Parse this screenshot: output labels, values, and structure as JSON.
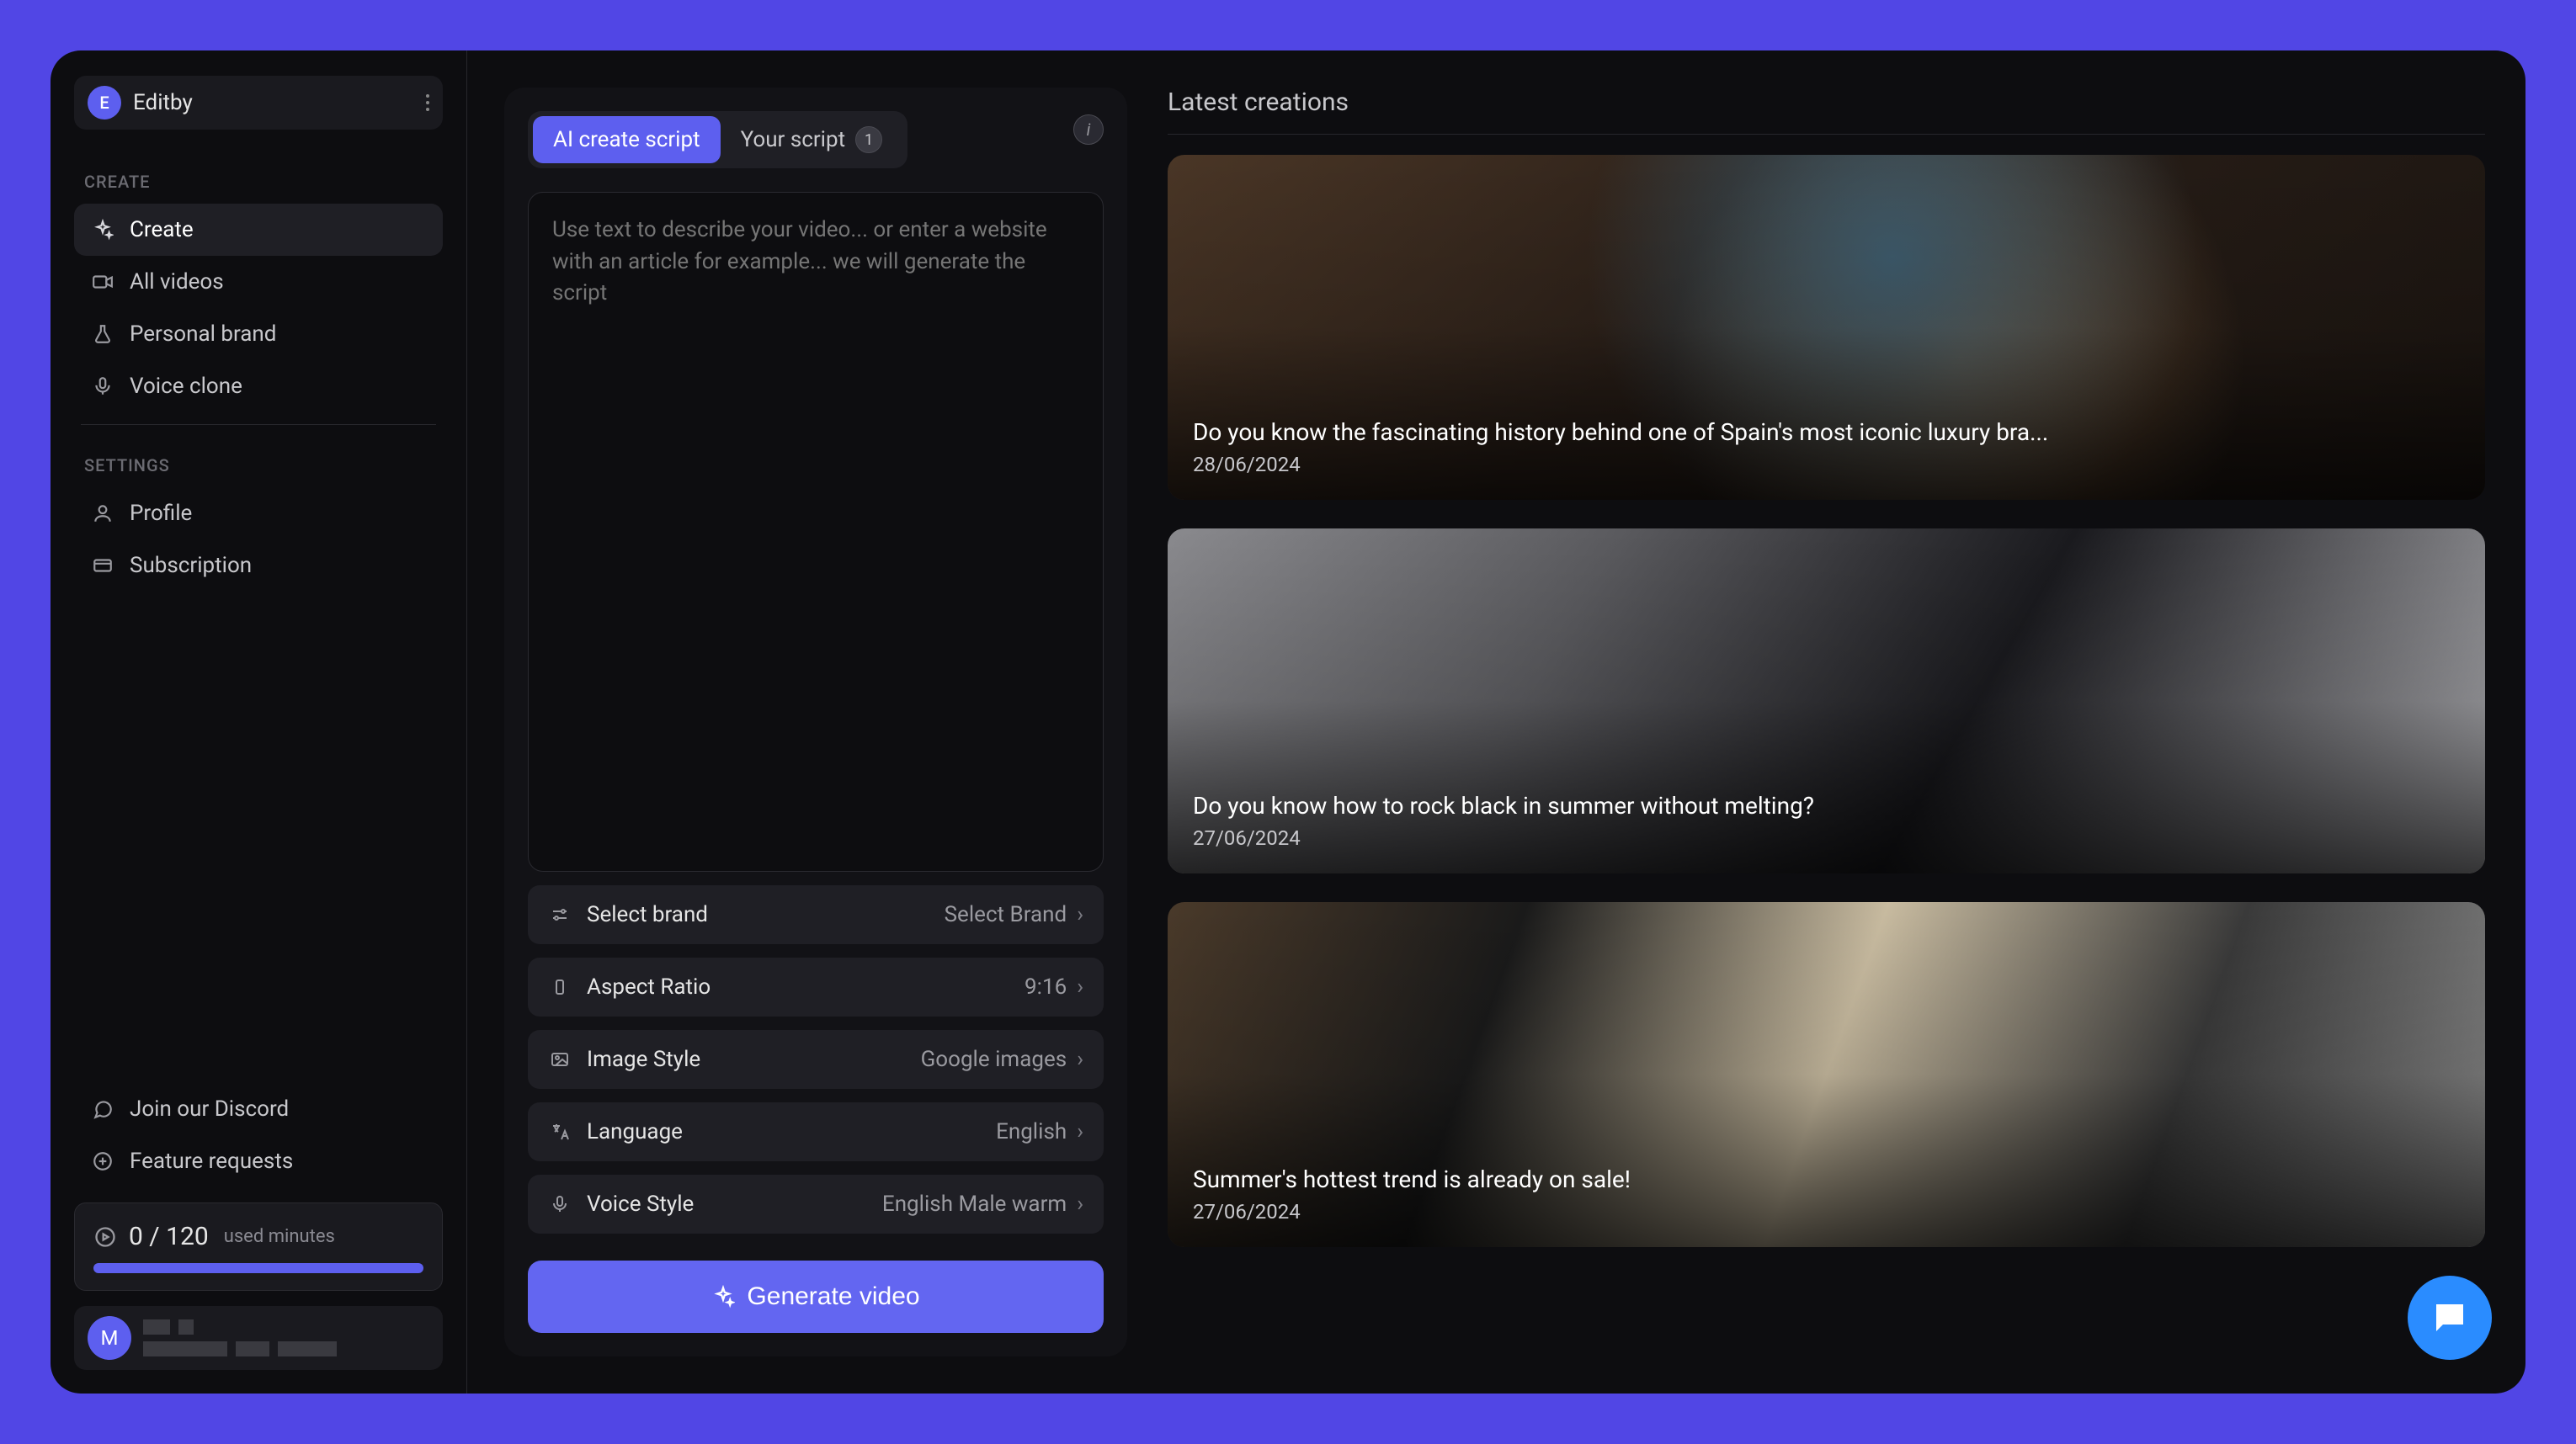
{
  "brand": {
    "avatar_letter": "E",
    "name": "Editby"
  },
  "sidebar": {
    "sections": {
      "create_label": "CREATE",
      "settings_label": "SETTINGS"
    },
    "items": {
      "create": "Create",
      "all_videos": "All videos",
      "personal_brand": "Personal brand",
      "voice_clone": "Voice clone",
      "profile": "Profile",
      "subscription": "Subscription",
      "discord": "Join our Discord",
      "feature_requests": "Feature requests"
    },
    "usage": {
      "text": "0 / 120",
      "sub": "used minutes"
    },
    "user": {
      "avatar_letter": "M"
    }
  },
  "editor": {
    "tabs": {
      "ai": "AI create script",
      "your": "Your script",
      "badge": "1"
    },
    "prompt_placeholder": "Use text to describe your video... or enter a website with an article for example... we will generate the script",
    "options": {
      "brand": {
        "label": "Select brand",
        "value": "Select Brand"
      },
      "aspect": {
        "label": "Aspect Ratio",
        "value": "9:16"
      },
      "image": {
        "label": "Image Style",
        "value": "Google images"
      },
      "language": {
        "label": "Language",
        "value": "English"
      },
      "voice": {
        "label": "Voice Style",
        "value": "English Male warm"
      }
    },
    "generate_label": "Generate video"
  },
  "creations": {
    "header": "Latest creations",
    "cards": [
      {
        "title": "Do you know the fascinating history behind one of Spain's most iconic luxury bra...",
        "date": "28/06/2024"
      },
      {
        "title": "Do you know how to rock black in summer without melting?",
        "date": "27/06/2024"
      },
      {
        "title": "Summer's hottest trend is already on sale!",
        "date": "27/06/2024"
      }
    ]
  }
}
